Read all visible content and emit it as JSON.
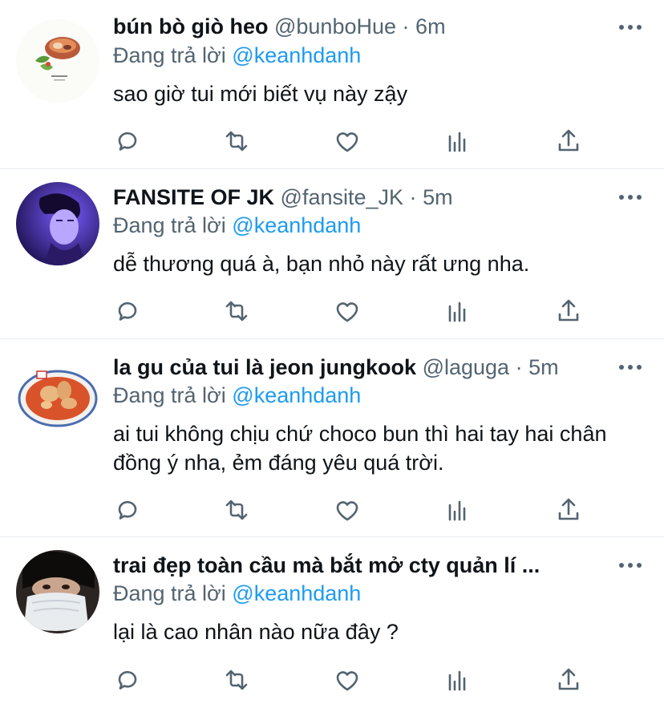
{
  "reply_prefix": "Đang trả lời",
  "tweets": [
    {
      "name": "bún bò giò heo",
      "handle": "@bunboHue",
      "sep": "·",
      "time": "6m",
      "reply_to": "@keanhdanh",
      "text": "sao giờ tui mới biết vụ này zậy",
      "avatar": "food-bowl"
    },
    {
      "name": "FANSITE OF JK",
      "handle": "@fansite_JK",
      "sep": "·",
      "time": "5m",
      "reply_to": "@keanhdanh",
      "text": "dễ thương quá à, bạn nhỏ này rất ưng nha.",
      "avatar": "purple-portrait"
    },
    {
      "name": "la gu của tui là jeon jungkook",
      "handle": "@laguga",
      "sep": "·",
      "time": "5m",
      "reply_to": "@keanhdanh",
      "text": "ai tui không chịu chứ choco bun thì hai tay hai chân đồng ý nha, ẻm đáng yêu quá trời.",
      "avatar": "curry-plate"
    },
    {
      "name": "trai đẹp toàn cầu mà bắt mở cty quản lí ...",
      "handle": "",
      "sep": "",
      "time": "",
      "reply_to": "@keanhdanh",
      "text": "lại là cao nhân nào nữa đây ?",
      "avatar": "masked-portrait"
    }
  ],
  "colors": {
    "secondary": "#536471",
    "link": "#1d9bf0",
    "divider": "#e6ecf0"
  }
}
